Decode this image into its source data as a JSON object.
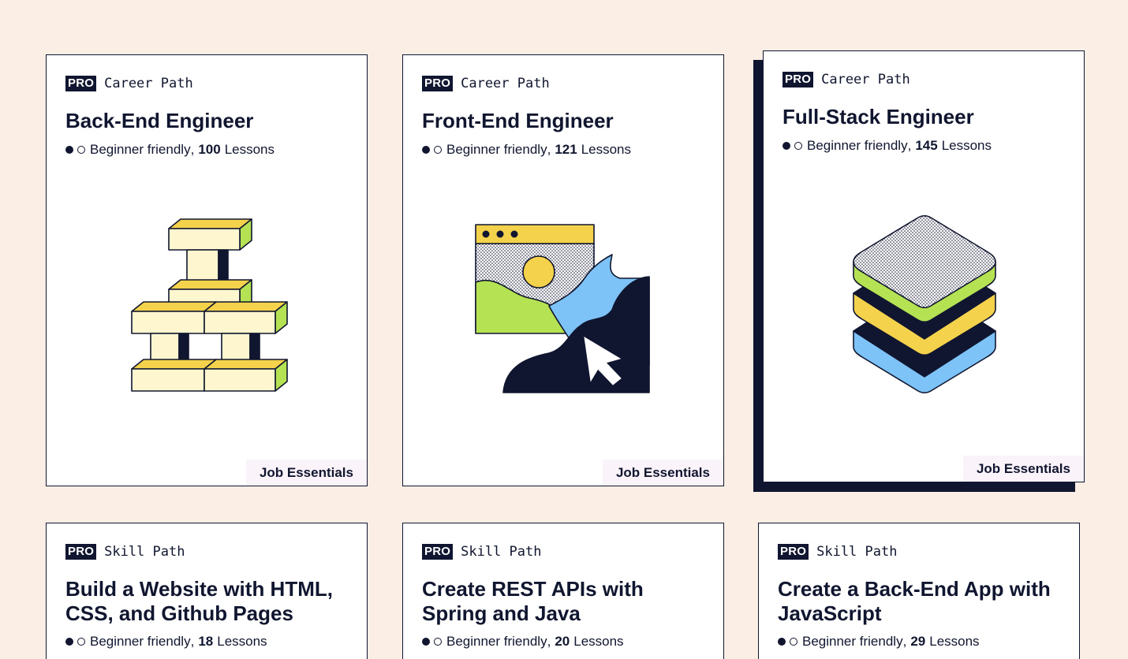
{
  "cards": [
    {
      "pro": "PRO",
      "type": "Career Path",
      "title": "Back-End Engineer",
      "difficulty": "Beginner friendly",
      "separator": ",",
      "lessons_count": "100",
      "lessons_label": "Lessons",
      "badge": "Job Essentials",
      "illustration": "stacked-blocks-icon"
    },
    {
      "pro": "PRO",
      "type": "Career Path",
      "title": "Front-End Engineer",
      "difficulty": "Beginner friendly",
      "separator": ",",
      "lessons_count": "121",
      "lessons_label": "Lessons",
      "badge": "Job Essentials",
      "illustration": "browser-window-cursor-icon"
    },
    {
      "pro": "PRO",
      "type": "Career Path",
      "title": "Full-Stack Engineer",
      "difficulty": "Beginner friendly",
      "separator": ",",
      "lessons_count": "145",
      "lessons_label": "Lessons",
      "badge": "Job Essentials",
      "illustration": "layer-stack-icon"
    },
    {
      "pro": "PRO",
      "type": "Skill Path",
      "title": "Build a Website with HTML, CSS, and Github Pages",
      "difficulty": "Beginner friendly",
      "separator": ",",
      "lessons_count": "18",
      "lessons_label": "Lessons"
    },
    {
      "pro": "PRO",
      "type": "Skill Path",
      "title": "Create REST APIs with Spring and Java",
      "difficulty": "Beginner friendly",
      "separator": ",",
      "lessons_count": "20",
      "lessons_label": "Lessons"
    },
    {
      "pro": "PRO",
      "type": "Skill Path",
      "title": "Create a Back-End App with JavaScript",
      "difficulty": "Beginner friendly",
      "separator": ",",
      "lessons_count": "29",
      "lessons_label": "Lessons"
    }
  ],
  "colors": {
    "background": "#fbeee4",
    "navy": "#10162f",
    "yellow": "#f5d24b",
    "green": "#b5e253",
    "blue": "#7ec3f7",
    "cream": "#fdf6cf",
    "badge_bg": "#fbf3fa"
  }
}
